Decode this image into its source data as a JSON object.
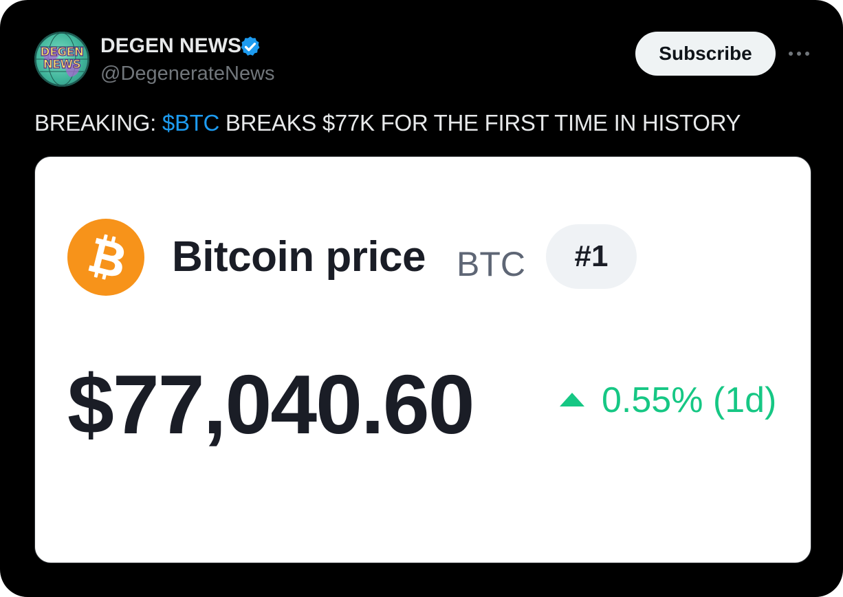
{
  "author": {
    "display_name": "DEGEN NEWS",
    "handle": "@DegenerateNews",
    "verified": true,
    "avatar_text_line1": "DEGEN",
    "avatar_text_line2": "NEWS"
  },
  "actions": {
    "subscribe_label": "Subscribe",
    "more_icon": "more-horizontal-icon"
  },
  "tweet": {
    "text_prefix": "BREAKING: ",
    "cashtag": "$BTC",
    "text_suffix": " BREAKS $77K FOR THE FIRST TIME IN HISTORY"
  },
  "media": {
    "coin_icon": "bitcoin-icon",
    "coin_title": "Bitcoin price",
    "coin_symbol": "BTC",
    "rank": "#1",
    "price": "$77,040.60",
    "change_icon": "triangle-up-icon",
    "change": "0.55% (1d)"
  },
  "colors": {
    "background": "#000000",
    "text_primary": "#e7e9ea",
    "text_secondary": "#71767b",
    "link": "#1d9bf0",
    "verified": "#1d9bf0",
    "bitcoin_orange": "#f7931a",
    "price_up": "#16c784",
    "card_text": "#1a1d26"
  }
}
